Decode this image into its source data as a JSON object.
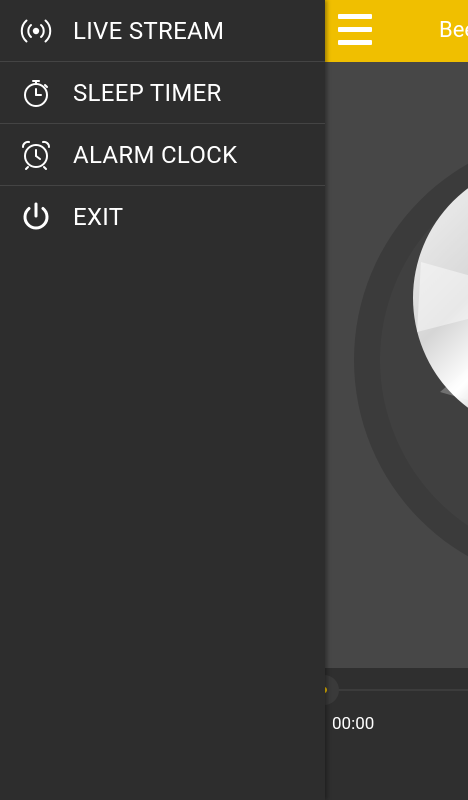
{
  "colors": {
    "accent": "#f0bf00",
    "drawer_background": "#2d2d2d",
    "content_background": "#474747",
    "text": "#ffffff"
  },
  "drawer": {
    "items": [
      {
        "label": "LIVE STREAM",
        "icon": "radio-broadcast-icon"
      },
      {
        "label": "SLEEP TIMER",
        "icon": "stopwatch-icon"
      },
      {
        "label": "ALARM CLOCK",
        "icon": "alarm-clock-icon"
      },
      {
        "label": "EXIT",
        "icon": "power-icon"
      }
    ]
  },
  "appbar": {
    "title": "Bee",
    "menu_icon": "hamburger-menu-icon"
  },
  "player": {
    "elapsed_time": "00:00",
    "progress": 0
  }
}
